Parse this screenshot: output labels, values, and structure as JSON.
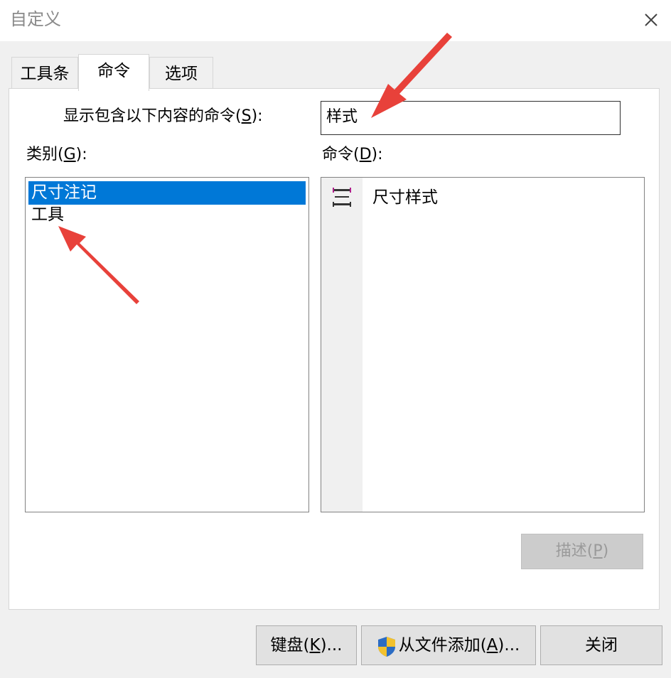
{
  "window": {
    "title": "自定义"
  },
  "tabs": [
    {
      "label": "工具条"
    },
    {
      "label": "命令"
    },
    {
      "label": "选项"
    }
  ],
  "filter": {
    "label_prefix": "显示包含以下内容的命令(",
    "label_key": "S",
    "label_suffix": "):",
    "value": "样式"
  },
  "categories": {
    "label_prefix": "类别(",
    "label_key": "G",
    "label_suffix": "):",
    "items": [
      {
        "label": "尺寸注记",
        "selected": true
      },
      {
        "label": "工具",
        "selected": false
      }
    ]
  },
  "commands": {
    "label_prefix": "命令(",
    "label_key": "D",
    "label_suffix": "):",
    "items": [
      {
        "label": "尺寸样式",
        "icon": "dimension-style-icon"
      }
    ]
  },
  "buttons": {
    "describe_prefix": "描述(",
    "describe_key": "P",
    "describe_suffix": ")",
    "keyboard_prefix": "键盘(",
    "keyboard_key": "K",
    "keyboard_suffix": ")...",
    "add_file_prefix": "从文件添加(",
    "add_file_key": "A",
    "add_file_suffix": ")...",
    "close": "关闭"
  },
  "colors": {
    "selection": "#0078d7",
    "annotation_arrow": "#e8413a"
  }
}
